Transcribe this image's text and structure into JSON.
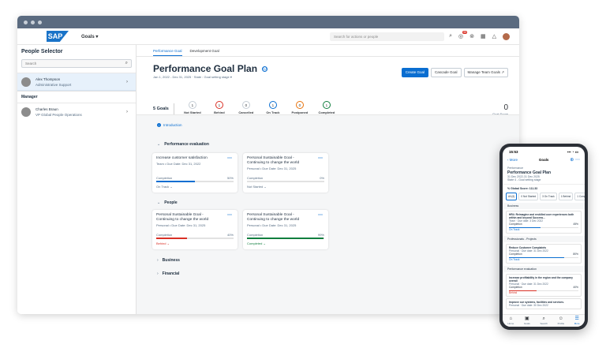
{
  "shell": {
    "logo": "SAP",
    "app_menu": "Goals ▾",
    "search_placeholder": "Search for actions or people",
    "notification_count": "99"
  },
  "left": {
    "title": "People Selector",
    "search_placeholder": "Search",
    "selected_person": {
      "name": "Alex Thompson",
      "role": "Administrative Support"
    },
    "manager_label": "Manager",
    "manager": {
      "name": "Charles Braun",
      "role": "VP Global People Operations"
    }
  },
  "tabs": [
    "Performance Goal",
    "Development Goal"
  ],
  "page": {
    "title": "Performance Goal Plan",
    "subtitle": "Jan 1, 2022 - Dec 31, 2025 · State : Goal setting stage ▾",
    "actions": {
      "create": "Create Goal",
      "cascade": "Cascade Goal",
      "manage": "Manage Team Goals"
    }
  },
  "stats": {
    "goals_label": "5 Goals",
    "items": [
      {
        "count": "1",
        "label": "Not Started",
        "color": "#c5cdd5"
      },
      {
        "count": "1",
        "label": "Behind",
        "color": "#d93025"
      },
      {
        "count": "0",
        "label": "Cancelled",
        "color": "#c5cdd5"
      },
      {
        "count": "1",
        "label": "On Track",
        "color": "#0a6ed1"
      },
      {
        "count": "0",
        "label": "Postponed",
        "color": "#e9730c"
      },
      {
        "count": "1",
        "label": "Completed",
        "color": "#107e3e"
      }
    ],
    "score_value": "0",
    "score_label": "Goal Score"
  },
  "intro_label": "Introduction",
  "sections": [
    {
      "title": "Performance evaluation",
      "expanded": "⌄"
    },
    {
      "title": "People",
      "expanded": "⌄"
    },
    {
      "title": "Business",
      "expanded": "›"
    },
    {
      "title": "Financial",
      "expanded": "›"
    }
  ],
  "cards": [
    {
      "title": "Increase customer satisfaction",
      "sub": "Team • Due Date: Dec 31, 2022",
      "completion_label": "Completion",
      "pct": "50%",
      "progress": 0.5,
      "bar_color": "#0a6ed1",
      "status": "On Track ⌄",
      "status_color": "#556b82"
    },
    {
      "title": "Personal Sustainable Goal - Continuing to change the world",
      "sub": "Personal • Due Date: Dec 31, 2025",
      "completion_label": "Completion",
      "pct": "0%",
      "progress": 0,
      "bar_color": "#c5cdd5",
      "status": "Not Started ⌄",
      "status_color": "#556b82"
    },
    {
      "title": "Personal Sustainable Goal - Continuing to change the world",
      "sub": "Personal • Due Date: Dec 31, 2025",
      "completion_label": "Completion",
      "pct": "40%",
      "progress": 0.4,
      "bar_color": "#d93025",
      "status": "Behind ⌄",
      "status_color": "#d93025"
    },
    {
      "title": "Personal Sustainable Goal - Continuing to change the world",
      "sub": "Personal • Due Date: Dec 31, 2025",
      "completion_label": "Completion",
      "pct": "99%",
      "progress": 0.99,
      "bar_color": "#107e3e",
      "status": "Completed ⌄",
      "status_color": "#107e3e"
    }
  ],
  "phone": {
    "time": "15:53",
    "signal": "▪▪▪ ◔ ▭",
    "back": "‹ More",
    "title": "Goals",
    "header_small": "Performance",
    "header_title": "Performance Goal Plan",
    "header_dates": "31 Dec 2022-31 Dec 2025",
    "header_state": "State 4 - Goal setting stage",
    "score": "% Global Score: 111.33",
    "chips": [
      "All (6)",
      "0 Not Started",
      "3 On Track",
      "1 Behind",
      "1 Comp"
    ],
    "groups": [
      {
        "name": "Business",
        "cards": [
          {
            "title": "HR4: Reimagine and reskilled user experiences both within and beyond Success...",
            "sub": "Team · Due date: 3 Dec 2022",
            "label": "Completion",
            "pct": "45%",
            "progress": 0.45,
            "color": "#0a6ed1",
            "status": "On Track"
          }
        ]
      },
      {
        "name": "Professionals - Projects",
        "cards": [
          {
            "title": "Reduce Customer Complaints",
            "sub": "Personal · Due date: 31 Dec 2022",
            "label": "Completion",
            "pct": "80%",
            "progress": 0.8,
            "color": "#0a6ed1",
            "status": "On Track"
          }
        ]
      },
      {
        "name": "Performance evaluation",
        "cards": [
          {
            "title": "Increase profitability in the region and the company overall",
            "sub": "Personal · Due date: 31 Dec 2022",
            "label": "Completion",
            "pct": "40%",
            "progress": 0.4,
            "color": "#d93025",
            "status": "Behind"
          },
          {
            "title": "Improve our systems, facilities and services.",
            "sub": "Personal · Due date: 30 Dec 2022",
            "label": "",
            "pct": "",
            "progress": 0,
            "color": "#e2e2e2",
            "status": ""
          }
        ]
      }
    ],
    "tabbar": [
      {
        "icon": "⌂",
        "label": "Home"
      },
      {
        "icon": "▣",
        "label": "Goals"
      },
      {
        "icon": "⌕",
        "label": "Search"
      },
      {
        "icon": "☺",
        "label": "Profile"
      },
      {
        "icon": "☰",
        "label": "More"
      }
    ]
  }
}
